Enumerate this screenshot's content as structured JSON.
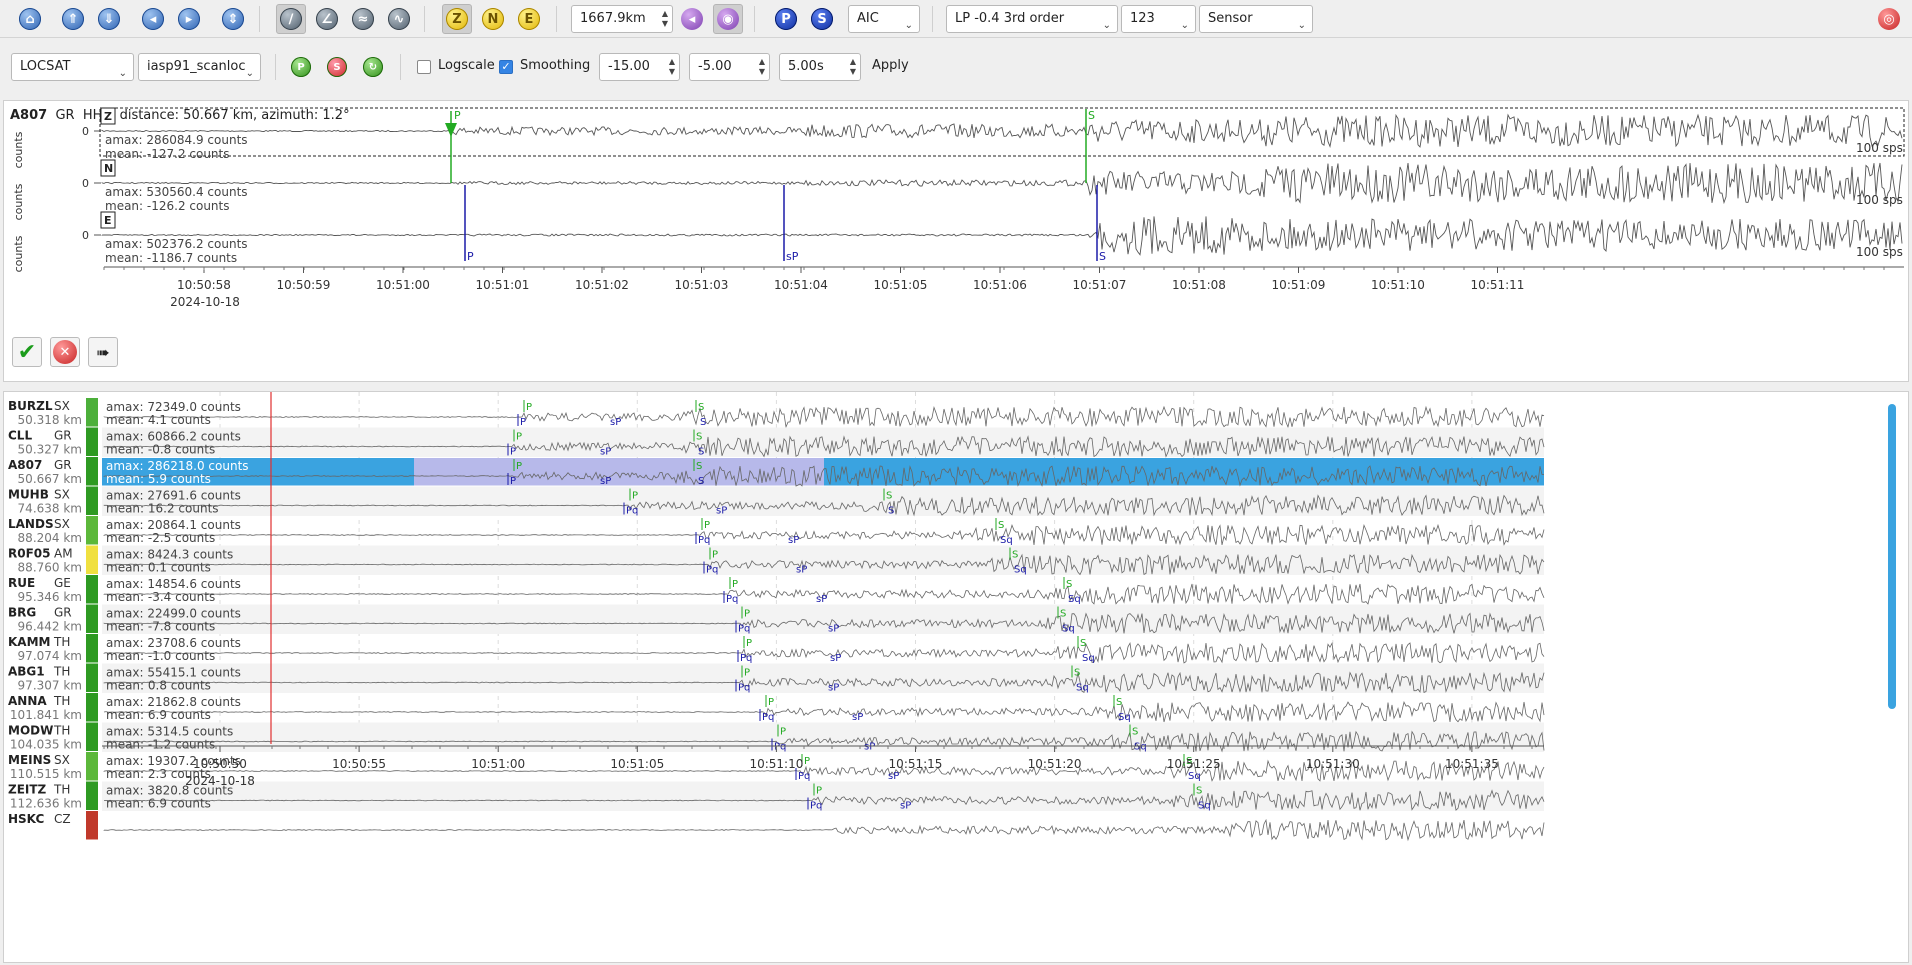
{
  "toolbar": {
    "distance": "1667.9km",
    "picker": "AIC",
    "filter": "LP -0.4  3rd order",
    "components": "123",
    "units": "Sensor",
    "buttons": {
      "z": "Z",
      "n": "N",
      "e": "E",
      "p": "P",
      "s": "S"
    },
    "locator": "LOCSAT",
    "profile": "iasp91_scanloc",
    "logscale_label": "Logscale",
    "logscale_on": false,
    "smoothing_label": "Smoothing",
    "smoothing_on": true,
    "from": "-15.00",
    "to": "-5.00",
    "window": "5.00s",
    "apply": "Apply",
    "icons": [
      "home-icon",
      "scroll-up-icon",
      "scroll-down-icon",
      "prev-icon",
      "next-icon",
      "collapse-icon",
      "pick-tool-icon",
      "zoom-tool-icon",
      "align-icon",
      "measure-icon",
      "pick-p-icon",
      "pick-s-icon",
      "target-icon"
    ]
  },
  "zoom_trace": {
    "station": "A807",
    "network": "GR",
    "channel": "HHZ",
    "info": ", distance: 50.667 km, azimuth: 1.2°",
    "ylabel": "counts",
    "zero": "0",
    "sps": "100 sps",
    "components": [
      {
        "name": "Z",
        "amax": "amax: 286084.9 counts",
        "mean": "mean: -127.2 counts"
      },
      {
        "name": "N",
        "amax": "amax: 530560.4 counts",
        "mean": "mean: -126.2 counts"
      },
      {
        "name": "E",
        "amax": "amax: 502376.2 counts",
        "mean": "mean: -1186.7 counts"
      }
    ],
    "picks": [
      {
        "comp": "Z",
        "label": "P",
        "kind": "manual"
      },
      {
        "comp": "Z",
        "label": "S",
        "kind": "manual"
      },
      {
        "comp": "E",
        "label": "P",
        "kind": "theoretical"
      },
      {
        "comp": "E",
        "label": "sP",
        "kind": "theoretical"
      },
      {
        "comp": "E",
        "label": "S",
        "kind": "theoretical"
      }
    ],
    "time_ticks": [
      "10:50:58",
      "10:50:59",
      "10:51:00",
      "10:51:01",
      "10:51:02",
      "10:51:03",
      "10:51:04",
      "10:51:05",
      "10:51:06",
      "10:51:07",
      "10:51:08",
      "10:51:09",
      "10:51:10",
      "10:51:11"
    ],
    "date": "2024-10-18",
    "actions": [
      "accept-icon",
      "reject-icon",
      "send-icon"
    ]
  },
  "stations": [
    {
      "code": "BURZL",
      "net": "SX",
      "dist": "50.318 km",
      "amax": "amax: 72349.0 counts",
      "mean": "mean: 4.1 counts",
      "bar": "#4caf3a"
    },
    {
      "code": "CLL",
      "net": "GR",
      "dist": "50.327 km",
      "amax": "amax: 60866.2 counts",
      "mean": "mean: -0.8 counts",
      "bar": "#2e9a22"
    },
    {
      "code": "A807",
      "net": "GR",
      "dist": "50.667 km",
      "amax": "amax: 286218.0 counts",
      "mean": "mean: 5.9 counts",
      "bar": "#2e9a22",
      "selected": true
    },
    {
      "code": "MUHB",
      "net": "SX",
      "dist": "74.638 km",
      "amax": "amax: 27691.6 counts",
      "mean": "mean: 16.2 counts",
      "bar": "#2e9a22"
    },
    {
      "code": "LANDS",
      "net": "SX",
      "dist": "88.204 km",
      "amax": "amax: 20864.1 counts",
      "mean": "mean: -2.5 counts",
      "bar": "#5cb83a"
    },
    {
      "code": "R0F05",
      "net": "AM",
      "dist": "88.760 km",
      "amax": "amax: 8424.3 counts",
      "mean": "mean: 0.1 counts",
      "bar": "#f0e040"
    },
    {
      "code": "RUE",
      "net": "GE",
      "dist": "95.346 km",
      "amax": "amax: 14854.6 counts",
      "mean": "mean: -3.4 counts",
      "bar": "#2e9a22"
    },
    {
      "code": "BRG",
      "net": "GR",
      "dist": "96.442 km",
      "amax": "amax: 22499.0 counts",
      "mean": "mean: -7.8 counts",
      "bar": "#2e9a22"
    },
    {
      "code": "KAMM",
      "net": "TH",
      "dist": "97.074 km",
      "amax": "amax: 23708.6 counts",
      "mean": "mean: -1.0 counts",
      "bar": "#2e9a22"
    },
    {
      "code": "ABG1",
      "net": "TH",
      "dist": "97.307 km",
      "amax": "amax: 55415.1 counts",
      "mean": "mean: 0.8 counts",
      "bar": "#2e9a22"
    },
    {
      "code": "ANNA",
      "net": "TH",
      "dist": "101.841 km",
      "amax": "amax: 21862.8 counts",
      "mean": "mean: 6.9 counts",
      "bar": "#2e9a22"
    },
    {
      "code": "MODW",
      "net": "TH",
      "dist": "104.035 km",
      "amax": "amax: 5314.5 counts",
      "mean": "mean: -1.2 counts",
      "bar": "#2e9a22"
    },
    {
      "code": "MEINS",
      "net": "SX",
      "dist": "110.515 km",
      "amax": "amax: 19307.2 counts",
      "mean": "mean: 2.3 counts",
      "bar": "#5cb83a"
    },
    {
      "code": "ZEITZ",
      "net": "TH",
      "dist": "112.636 km",
      "amax": "amax: 3820.8 counts",
      "mean": "mean: 6.9 counts",
      "bar": "#2e9a22"
    },
    {
      "code": "HSKC",
      "net": "CZ",
      "dist": "",
      "amax": "",
      "mean": "",
      "bar": "#c0392b"
    }
  ],
  "overview_ticks": [
    "10:50:50",
    "10:50:55",
    "10:51:00",
    "10:51:05",
    "10:51:10",
    "10:51:15",
    "10:51:20",
    "10:51:25",
    "10:51:30",
    "10:51:35"
  ],
  "overview_date": "2024-10-18",
  "colors": {
    "manual_pick": "#22aa22",
    "theoretical_pick": "#1a1aa8",
    "selection": "#3aa3e0",
    "origin_line": "#e03030"
  }
}
